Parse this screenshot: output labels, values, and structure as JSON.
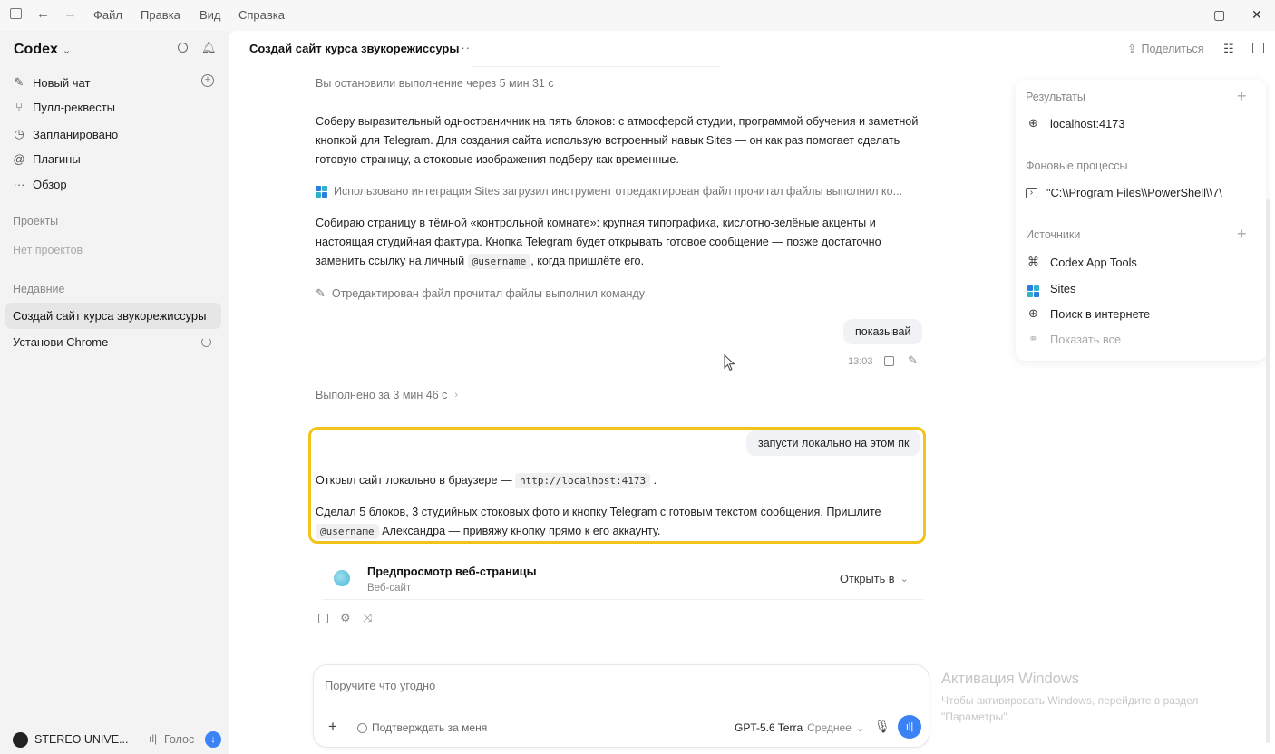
{
  "menubar": {
    "items": [
      "Файл",
      "Правка",
      "Вид",
      "Справка"
    ]
  },
  "window_controls": {
    "minimize": "—",
    "maximize": "▢",
    "close": "✕"
  },
  "sidebar": {
    "app_name": "Codex",
    "nav": [
      {
        "label": "Новый чат",
        "icon": "edit-icon"
      },
      {
        "label": "Пулл-реквесты",
        "icon": "pull-request-icon"
      },
      {
        "label": "Запланировано",
        "icon": "clock-icon"
      },
      {
        "label": "Плагины",
        "icon": "at-icon"
      },
      {
        "label": "Обзор",
        "icon": "more-icon"
      }
    ],
    "projects_header": "Проекты",
    "projects_empty": "Нет проектов",
    "recent_header": "Недавние",
    "recent": [
      {
        "label": "Создай сайт курса звукорежиссуры",
        "active": true
      },
      {
        "label": "Установи Chrome",
        "active": false
      }
    ],
    "user": "STEREO UNIVE...",
    "voice_label": "Голос"
  },
  "header": {
    "title": "Создай сайт курса звукорежиссуры",
    "more": "···",
    "share_label": "Поделиться"
  },
  "chat": {
    "stopped_note": "Вы остановили выполнение через 5 мин 31 с",
    "para1": "Соберу выразительный одностраничник на пять блоков: с атмосферой студии, программой обучения и заметной кнопкой для Telegram. Для создания сайта использую встроенный навык Sites — он как раз помогает сделать готовую страницу, а стоковые изображения подберу как временные.",
    "tool_line1": "Использовано интеграция Sites загрузил инструмент отредактирован файл прочитал файлы выполнил ко...",
    "para2_a": "Собираю страницу в тёмной «контрольной комнате»: крупная типографика, кислотно-зелёные акценты и настоящая студийная фактура. Кнопка Telegram будет открывать готовое сообщение — позже достаточно заменить ссылку на личный",
    "para2_code": "@username",
    "para2_b": ", когда пришлёте его.",
    "tool_line2": "Отредактирован файл прочитал файлы выполнил команду",
    "user_msg1": "показывай",
    "user_msg1_time": "13:03",
    "done_note": "Выполнено за 3 мин 46 с",
    "user_msg2": "запусти локально на этом пк",
    "reply1_a": "Открыл сайт локально в браузере —",
    "reply1_code": "http://localhost:4173",
    "reply1_b": ".",
    "reply2_a": "Сделал 5 блоков, 3 студийных стоковых фото и кнопку Telegram с готовым текстом сообщения. Пришлите",
    "reply2_code": "@username",
    "reply2_b": "Александра — привяжу кнопку прямо к его аккаунту.",
    "preview_title": "Предпросмотр веб-страницы",
    "preview_sub": "Веб-сайт",
    "preview_open": "Открыть в"
  },
  "right_panel": {
    "results_header": "Результаты",
    "results": [
      "localhost:4173"
    ],
    "bg_header": "Фоновые процессы",
    "bg_items": [
      "\"C:\\\\Program Files\\\\PowerShell\\\\7\\"
    ],
    "sources_header": "Источники",
    "sources": [
      {
        "label": "Codex App Tools",
        "icon": "grid-icon"
      },
      {
        "label": "Sites",
        "icon": "sites-icon"
      },
      {
        "label": "Поиск в интернете",
        "icon": "globe-icon"
      }
    ],
    "show_all": "Показать все"
  },
  "composer": {
    "placeholder": "Поручите что угодно",
    "approve_label": "Подтверждать за меня",
    "model_label": "GPT-5.6 Terra",
    "effort_label": "Среднее"
  },
  "windows_activation": {
    "title": "Активация Windows",
    "text": "Чтобы активировать Windows, перейдите в раздел \"Параметры\"."
  },
  "colors": {
    "highlight": "#f0c419",
    "send_button": "#3b82f6",
    "sites_blue": "#2a7de1",
    "sites_teal": "#30b3c9"
  }
}
